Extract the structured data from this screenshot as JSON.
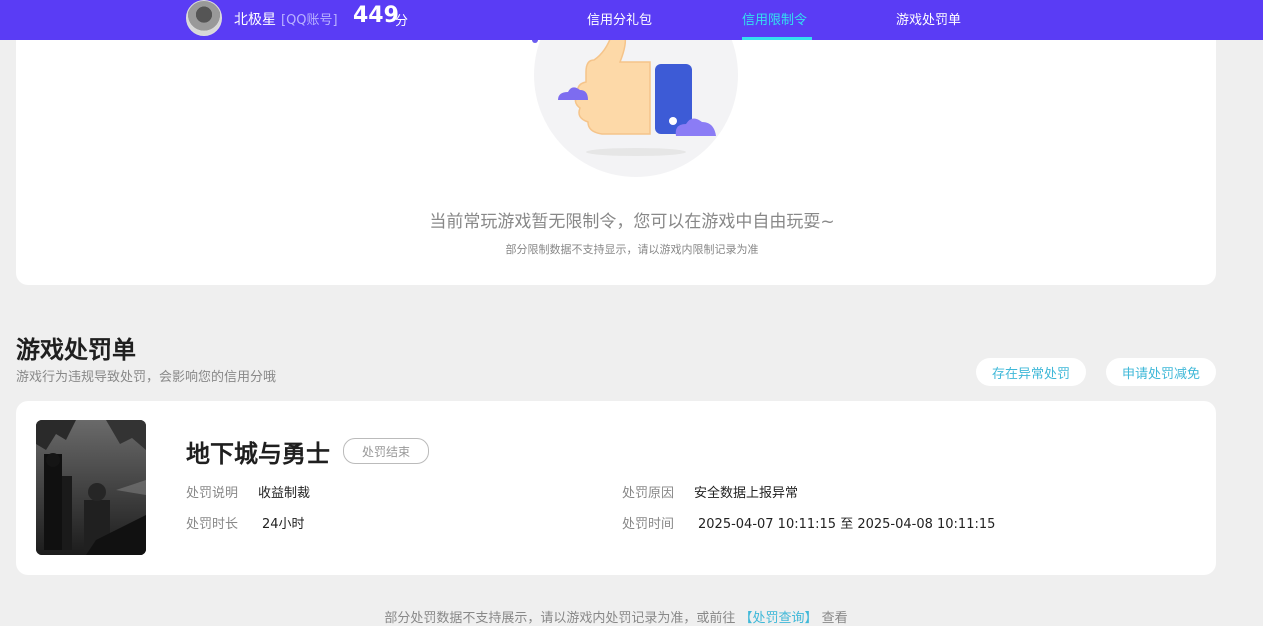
{
  "header": {
    "user_name": "北极星",
    "account_type": "[QQ账号]",
    "score": "449",
    "score_unit": "分",
    "tabs": [
      {
        "label": "信用分礼包",
        "active": false
      },
      {
        "label": "信用限制令",
        "active": true
      },
      {
        "label": "游戏处罚单",
        "active": false
      }
    ]
  },
  "restrictions": {
    "empty_message": "当前常玩游戏暂无限制令，您可以在游戏中自由玩耍~",
    "note": "部分限制数据不支持显示，请以游戏内限制记录为准"
  },
  "penalties": {
    "title": "游戏处罚单",
    "subtitle": "游戏行为违规导致处罚，会影响您的信用分哦",
    "buttons": {
      "abnormal": "存在异常处罚",
      "reduce": "申请处罚减免"
    },
    "items": [
      {
        "game": "地下城与勇士",
        "status": "处罚结束",
        "desc_label": "处罚说明",
        "desc_value": "收益制裁",
        "duration_label": "处罚时长",
        "duration_value": "24小时",
        "reason_label": "处罚原因",
        "reason_value": "安全数据上报异常",
        "time_label": "处罚时间",
        "time_value": "2025-04-07 10:11:15 至 2025-04-08 10:11:15"
      }
    ],
    "footer_text": "部分处罚数据不支持展示，请以游戏内处罚记录为准，或前往",
    "footer_link": "【处罚查询】",
    "footer_suffix": "查看"
  },
  "colors": {
    "topbar": "#5a3cf5",
    "accent": "#33e0f0",
    "link": "#3fb8d8"
  }
}
